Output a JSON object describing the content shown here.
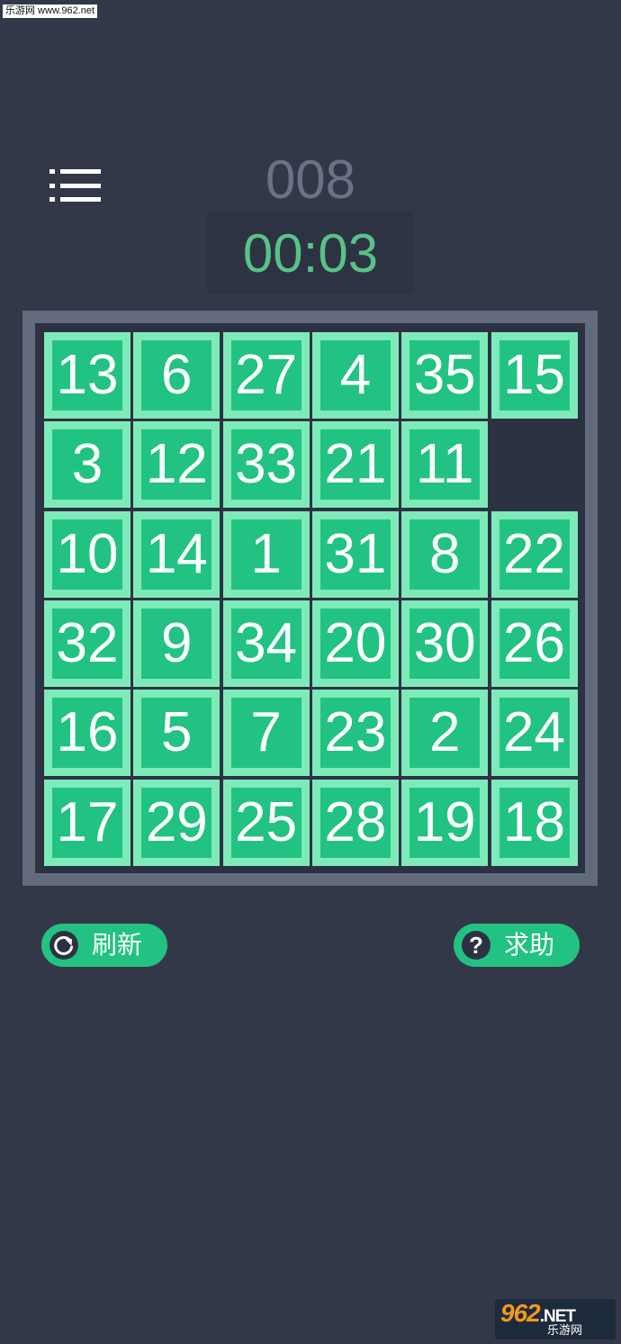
{
  "watermark": {
    "top_text": "乐游网 www.962.net",
    "logo_brand": "962",
    "logo_domain": ".NET",
    "logo_subtitle": "乐游网"
  },
  "header": {
    "menu_icon": "list-menu-icon",
    "level": "008",
    "timer": "00:03"
  },
  "board": {
    "rows": 6,
    "cols": 6,
    "tiles": [
      [
        "13",
        "6",
        "27",
        "4",
        "35",
        "15"
      ],
      [
        "3",
        "12",
        "33",
        "21",
        "11",
        ""
      ],
      [
        "10",
        "14",
        "1",
        "31",
        "8",
        "22"
      ],
      [
        "32",
        "9",
        "34",
        "20",
        "30",
        "26"
      ],
      [
        "16",
        "5",
        "7",
        "23",
        "2",
        "24"
      ],
      [
        "17",
        "29",
        "25",
        "28",
        "19",
        "18"
      ]
    ]
  },
  "controls": {
    "refresh_label": "刷新",
    "refresh_icon": "refresh-icon",
    "help_label": "求助",
    "help_icon": "question-icon",
    "help_mark": "?"
  },
  "colors": {
    "background": "#333849",
    "tile_fill": "#22c382",
    "tile_border": "#7feab9",
    "board_frame": "#626a7d",
    "timer": "#58c287",
    "level": "#6b7186"
  }
}
